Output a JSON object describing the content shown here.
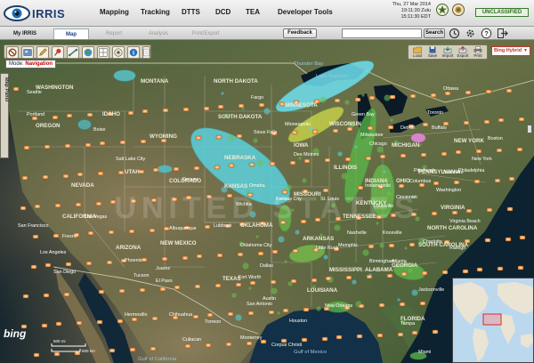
{
  "app": {
    "name": "IRRIS"
  },
  "nav": [
    "Mapping",
    "Tracking",
    "DTTS",
    "DCD",
    "TEA",
    "Developer Tools"
  ],
  "datetime": [
    "Thu, 27 Mar 2014",
    "19:11:30 Zulu",
    "15:11:30 EDT"
  ],
  "classification": "UNCLASSIFIED",
  "tabs": [
    "My IRRIS",
    "Map",
    "Report",
    "Analysis",
    "Print/Export"
  ],
  "feedback_label": "Feedback",
  "search": {
    "button_label": "Search",
    "placeholder": ""
  },
  "mode": {
    "label": "Mode:",
    "value": "Navigation"
  },
  "map_tools": [
    "Load",
    "Save",
    "Import",
    "Export",
    "Print"
  ],
  "basemap": "Bing Hybrid",
  "side_panel_label": "Map Panel",
  "bing_logo": "bing",
  "scale": {
    "top": "500 mi",
    "bottom": "500 km"
  },
  "map_labels": {
    "countries": [
      "UNITED STATES"
    ],
    "states": [
      "MONTANA",
      "NORTH DAKOTA",
      "SOUTH DAKOTA",
      "WYOMING",
      "NEBRASKA",
      "KANSAS",
      "MISSOURI",
      "ILLINOIS",
      "IOWA",
      "COLORADO",
      "UTAH",
      "NEVADA",
      "IDAHO",
      "OREGON",
      "WASHINGTON",
      "CALIFORNIA",
      "ARIZONA",
      "NEW MEXICO",
      "TEXAS",
      "OKLAHOMA",
      "ARKANSAS",
      "TENNESSEE",
      "KENTUCKY",
      "GEORGIA",
      "SOUTH CAROLINA",
      "ALABAMA",
      "MISSISSIPPI",
      "LOUISIANA",
      "VIRGINIA",
      "NORTH CAROLINA",
      "PENNSYLVANIA",
      "NEW YORK",
      "MICHIGAN",
      "WISCONSIN",
      "MINNESOTA",
      "OHIO",
      "INDIANA",
      "FLORIDA"
    ],
    "cities": [
      "Chicago",
      "Detroit",
      "Toronto",
      "Ottawa",
      "Denver",
      "Phoenix",
      "Los Angeles",
      "San Diego",
      "Las Vegas",
      "Salt Lake City",
      "Dallas",
      "Houston",
      "San Antonio",
      "Austin",
      "New Orleans",
      "Atlanta",
      "Memphis",
      "Nashville",
      "St. Louis",
      "Kansas City",
      "Oklahoma City",
      "Albuquerque",
      "El Paso",
      "Fort Worth",
      "Jacksonville",
      "Miami",
      "Tampa",
      "Charlotte",
      "Virginia Beach",
      "Washington",
      "Cincinnati",
      "Columbus",
      "Milwaukee",
      "Minneapolis",
      "Omaha",
      "Boston",
      "New York",
      "Philadelphia",
      "Buffalo",
      "Hermosillo",
      "Chihuahua",
      "Monterrey",
      "Torreon",
      "Culiacan",
      "San Francisco",
      "Fresno",
      "Boise",
      "Seattle",
      "Portland",
      "Tucson",
      "Juarez",
      "Little Rock",
      "Birmingham",
      "Wichita",
      "Lubbock",
      "Corpus Christi",
      "Pittsburgh",
      "Raleigh",
      "Knoxville",
      "Louisville",
      "Indianapolis",
      "Des Moines",
      "Fargo",
      "Sioux Falls",
      "Green Bay",
      "Baltimore"
    ],
    "water": [
      "Gulf of Mexico",
      "Gulf of California",
      "Lake Superior",
      "Thunder Bay"
    ]
  },
  "colors": {
    "brand": "#1c3d6e",
    "classification": "#2b6d22",
    "basemap": "#c0392b",
    "icon_marker": "#f0a050"
  }
}
